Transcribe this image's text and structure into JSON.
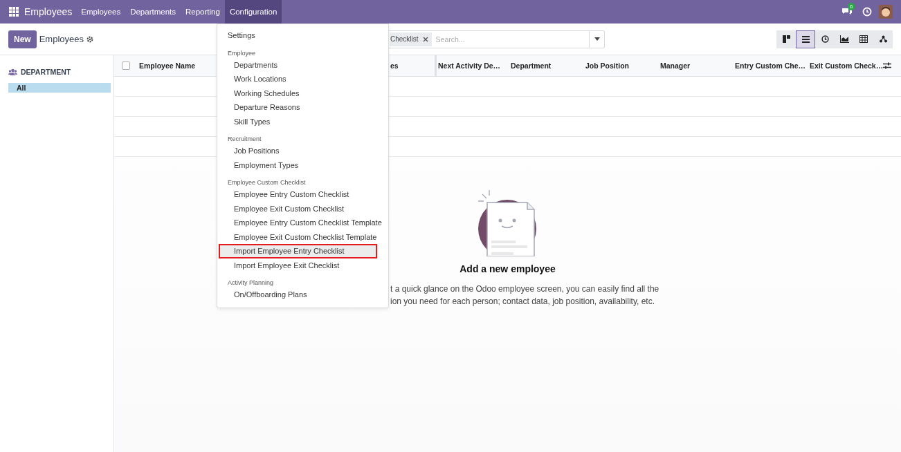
{
  "navbar": {
    "app_name": "Employees",
    "menu": [
      {
        "label": "Employees",
        "selected": false
      },
      {
        "label": "Departments",
        "selected": false
      },
      {
        "label": "Reporting",
        "selected": false
      },
      {
        "label": "Configuration",
        "selected": true
      }
    ],
    "chat_badge": "6"
  },
  "control_panel": {
    "new_button": "New",
    "title": "Employees",
    "facet": "Checklist",
    "search": {
      "placeholder": "Search..."
    },
    "views": [
      {
        "kind": "kanban",
        "selected": false
      },
      {
        "kind": "list",
        "selected": true
      },
      {
        "kind": "activity",
        "selected": false
      },
      {
        "kind": "graph",
        "selected": false
      },
      {
        "kind": "pivot",
        "selected": false
      },
      {
        "kind": "hierarchy",
        "selected": false
      }
    ]
  },
  "sidebar": {
    "heading": "DEPARTMENT",
    "items": [
      {
        "label": "All",
        "selected": true
      }
    ]
  },
  "table": {
    "select_all_checked": false,
    "columns": [
      "Employee Name",
      "es",
      "Next Activity De…",
      "Department",
      "Job Position",
      "Manager",
      "Entry Custom Che…",
      "Exit Custom Check…"
    ]
  },
  "empty_state": {
    "title": "Add a new employee",
    "text_lines": [
      "t a quick glance on the Odoo employee screen, you can easily find all the",
      "ion you need for each person; contact data, job position, availability, etc."
    ]
  },
  "dropdown": {
    "sections": [
      {
        "items": [
          {
            "label": "Settings",
            "selected": false
          }
        ]
      },
      {
        "heading": "Employee",
        "items": [
          {
            "label": "Departments",
            "selected": false
          },
          {
            "label": "Work Locations",
            "selected": false
          },
          {
            "label": "Working Schedules",
            "selected": false
          },
          {
            "label": "Departure Reasons",
            "selected": false
          },
          {
            "label": "Skill Types",
            "selected": false
          }
        ]
      },
      {
        "heading": "Recruitment",
        "items": [
          {
            "label": "Job Positions",
            "selected": false
          },
          {
            "label": "Employment Types",
            "selected": false
          }
        ]
      },
      {
        "heading": "Employee Custom Checklist",
        "items": [
          {
            "label": "Employee Entry Custom Checklist",
            "selected": false
          },
          {
            "label": "Employee Exit Custom Checklist",
            "selected": false
          },
          {
            "label": "Employee Entry Custom Checklist Template",
            "selected": false
          },
          {
            "label": "Employee Exit Custom Checklist Template",
            "selected": false
          },
          {
            "label": "Import Employee Entry Checklist",
            "selected": true
          },
          {
            "label": "Import Employee Exit Checklist",
            "selected": false
          }
        ]
      },
      {
        "heading": "Activity Planning",
        "items": [
          {
            "label": "On/Offboarding Plans",
            "selected": false
          }
        ]
      }
    ]
  }
}
